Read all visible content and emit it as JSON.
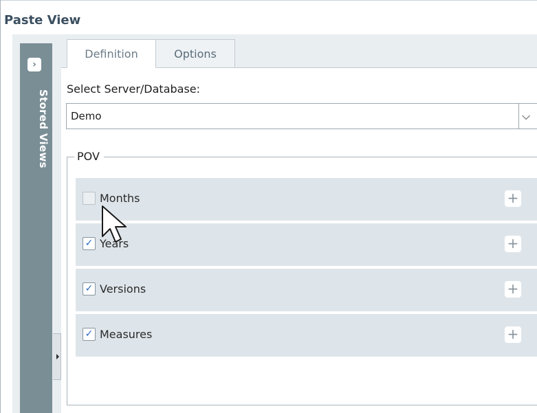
{
  "panel": {
    "title": "Paste View"
  },
  "sidebar": {
    "label": "Stored Views",
    "expand_glyph": "›"
  },
  "tabs": [
    {
      "label": "Definition",
      "active": true
    },
    {
      "label": "Options",
      "active": false
    }
  ],
  "server": {
    "label": "Select Server/Database:",
    "selected": "Demo",
    "arrow_glyph": "⌵"
  },
  "pov": {
    "legend": "POV",
    "rows": [
      {
        "label": "Months",
        "checked": false,
        "check_glyph": "",
        "plus_glyph": "+"
      },
      {
        "label": "Years",
        "checked": true,
        "check_glyph": "✓",
        "plus_glyph": "+"
      },
      {
        "label": "Versions",
        "checked": true,
        "check_glyph": "✓",
        "plus_glyph": "+"
      },
      {
        "label": "Measures",
        "checked": true,
        "check_glyph": "✓",
        "plus_glyph": "+"
      }
    ]
  },
  "colors": {
    "title": "#3b4f60",
    "rail": "#7a8e96",
    "row_bg": "#dee5ea",
    "check": "#2a6cc4"
  },
  "icons": {
    "rail_button": "chevron-right-icon",
    "dropdown": "chevron-down-icon",
    "add": "plus-icon",
    "splitter": "collapse-arrow-icon",
    "cursor": "mouse-pointer-icon"
  }
}
